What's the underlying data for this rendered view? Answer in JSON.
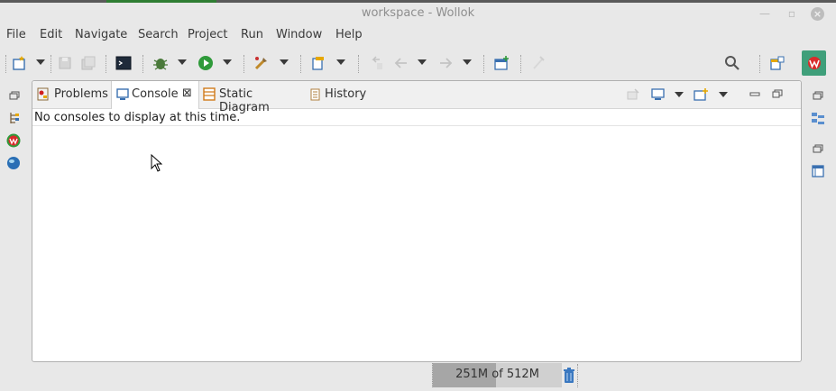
{
  "window": {
    "title": "workspace - Wollok",
    "minimize_glyph": "—",
    "restore_glyph": "▫",
    "close_glyph": "×"
  },
  "menu": [
    "File",
    "Edit",
    "Navigate",
    "Search",
    "Project",
    "Run",
    "Window",
    "Help"
  ],
  "toolbar": {
    "icons": [
      "new-wizard-icon",
      "save-icon",
      "save-all-icon",
      "open-terminal-icon",
      "debug-icon",
      "run-icon",
      "external-tools-icon",
      "new-java-package-icon",
      "last-edit-location-icon",
      "back-icon",
      "forward-icon",
      "open-perspective-icon",
      "pin-icon",
      "search-icon",
      "perspective-switcher-icon",
      "wollok-perspective-icon"
    ]
  },
  "view": {
    "tabs": [
      {
        "label": "Problems",
        "icon": "problems-icon"
      },
      {
        "label": "Console",
        "icon": "console-icon",
        "active": true,
        "close_glyph": "⊠"
      },
      {
        "label": "Static Diagram",
        "icon": "static-diagram-icon"
      },
      {
        "label": "History",
        "icon": "history-icon"
      }
    ],
    "console_message": "No consoles to display at this time."
  },
  "status": {
    "heap": "251M of 512M",
    "heap_used_fraction": 0.49
  },
  "colors": {
    "accent_red_tile": "#3f9f7a",
    "run_green": "#2f9a3a"
  }
}
